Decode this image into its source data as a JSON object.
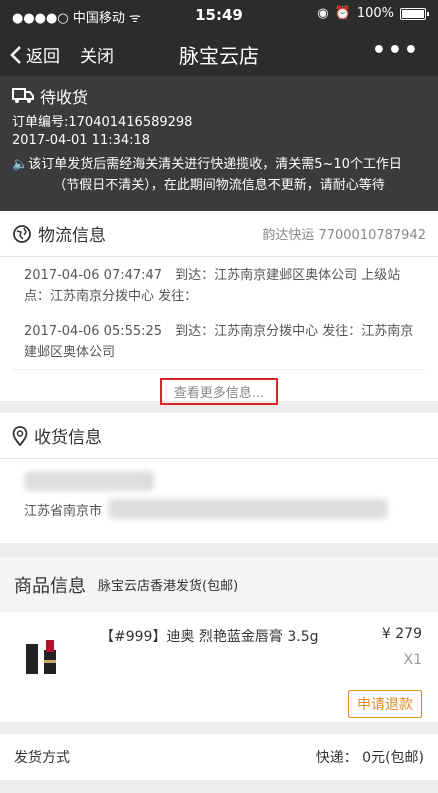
{
  "status_bar": {
    "carrier": "●●●●○ 中国移动 ᯤ",
    "time": "15:49",
    "battery": "100%"
  },
  "nav": {
    "back_label": "返回",
    "close_label": "关闭",
    "title": "脉宝云店",
    "more": "•••"
  },
  "order": {
    "status": "待收货",
    "number": "订单编号:170401416589298",
    "time": "2017-04-01 11:34:18",
    "notice_line1": "该订单发货后需经海关清关进行快递揽收，清关需5~10个工作日",
    "notice_line2": "（节假日不清关），在此期间物流信息不更新，请耐心等待"
  },
  "logistics": {
    "title": "物流信息",
    "carrier": "韵达快运 7700010787942",
    "entries": [
      {
        "text": "2017-04-06 07:47:47　到达：江苏南京建邺区奥体公司 上级站点：江苏南京分拨中心 发往："
      },
      {
        "text": "2017-04-06 05:55:25　到达：江苏南京分拨中心 发往：江苏南京建邺区奥体公司"
      }
    ],
    "more_label": "查看更多信息..."
  },
  "receiver": {
    "title": "收货信息",
    "address_prefix": "江苏省南京市"
  },
  "goods": {
    "title": "商品信息",
    "subtitle": "脉宝云店香港发货(包邮)",
    "name": "【#999】迪奥 烈艳蓝金唇膏 3.5g",
    "price": "¥ 279",
    "qty": "X1",
    "refund_label": "申请退款"
  },
  "shipping": {
    "label": "发货方式",
    "value": "快递：  0元(包邮)"
  }
}
